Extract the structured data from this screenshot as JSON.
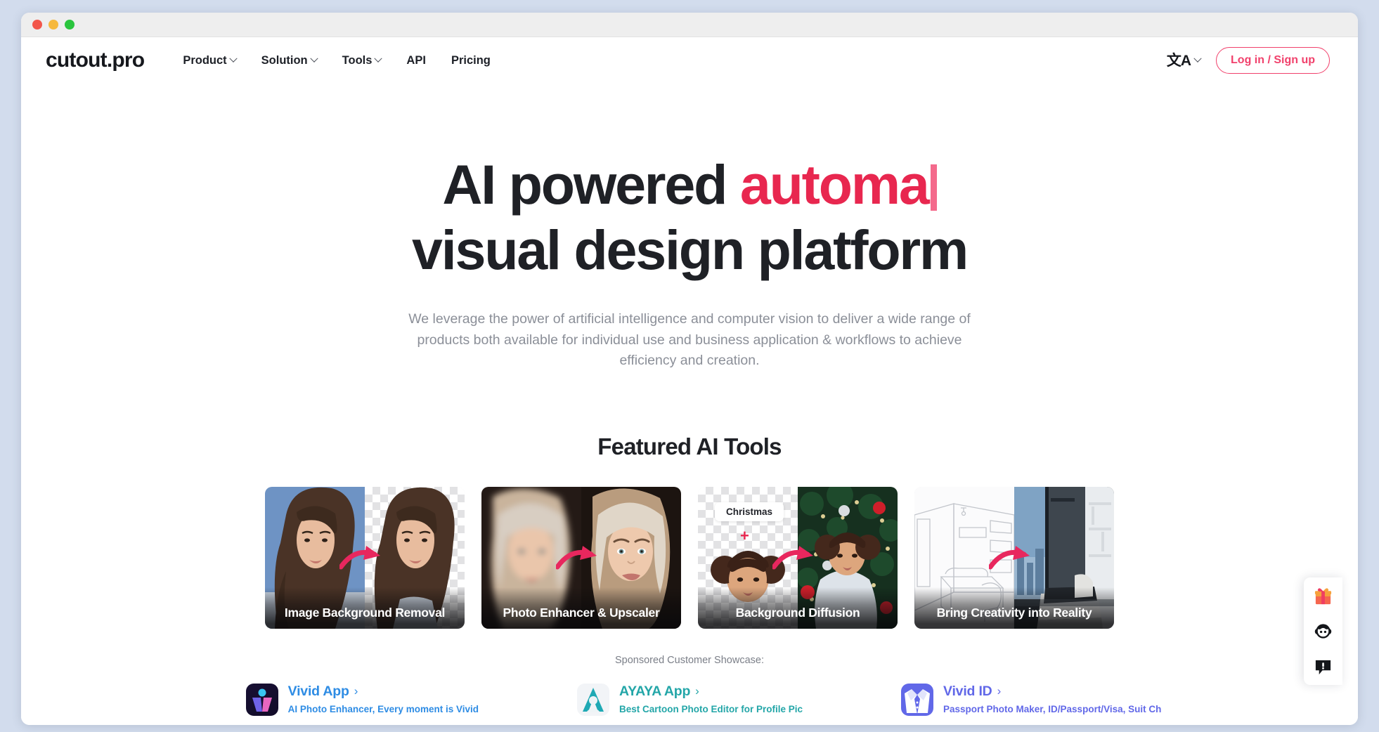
{
  "window": {
    "traffic_lights": [
      "close",
      "minimize",
      "maximize"
    ]
  },
  "nav": {
    "logo": "cutout.pro",
    "links": [
      {
        "label": "Product",
        "has_dropdown": true
      },
      {
        "label": "Solution",
        "has_dropdown": true
      },
      {
        "label": "Tools",
        "has_dropdown": true
      },
      {
        "label": "API",
        "has_dropdown": false
      },
      {
        "label": "Pricing",
        "has_dropdown": false
      }
    ],
    "language_icon": "translate-icon",
    "language_glyph": "文A",
    "login_label": "Log in / Sign up"
  },
  "hero": {
    "line1_static": "AI powered ",
    "line1_typed": "automa",
    "line2": "visual design platform",
    "subtitle": "We leverage the power of artificial intelligence and computer vision to deliver a wide range of products both available for individual use and business application & workflows to achieve efficiency and creation."
  },
  "featured": {
    "title": "Featured AI Tools",
    "cards": [
      {
        "label": "Image Background Removal",
        "badge": null
      },
      {
        "label": "Photo Enhancer & Upscaler",
        "badge": null
      },
      {
        "label": "Background Diffusion",
        "badge": "Christmas",
        "plus": "+"
      },
      {
        "label": "Bring Creativity into Reality",
        "badge": null
      }
    ]
  },
  "showcase": {
    "caption": "Sponsored Customer Showcase:",
    "items": [
      {
        "name": "Vivid App",
        "chevron": "›",
        "description": "AI Photo Enhancer, Every moment is Vivid",
        "icon": "vivid-app-icon",
        "color": "#2e8ce4"
      },
      {
        "name": "AYAYA App",
        "chevron": "›",
        "description": "Best Cartoon Photo Editor for Profile Pic",
        "icon": "ayaya-app-icon",
        "color": "#23a6a8"
      },
      {
        "name": "Vivid ID",
        "chevron": "›",
        "description": "Passport Photo Maker, ID/Passport/Visa, Suit Ch",
        "icon": "vivid-id-icon",
        "color": "#6168e8"
      }
    ]
  },
  "fab_rail": {
    "buttons": [
      {
        "icon": "gift-icon",
        "name": "gift"
      },
      {
        "icon": "support-face-icon",
        "name": "customer-support"
      },
      {
        "icon": "feedback-bubble-icon",
        "name": "feedback"
      }
    ]
  },
  "colors": {
    "accent_pink": "#e8274f",
    "login_pink": "#f1416c",
    "text_dark": "#1f2126",
    "text_muted": "#8b8f98",
    "page_bg": "#ffffff",
    "desktop_bg": "#d2dced"
  }
}
